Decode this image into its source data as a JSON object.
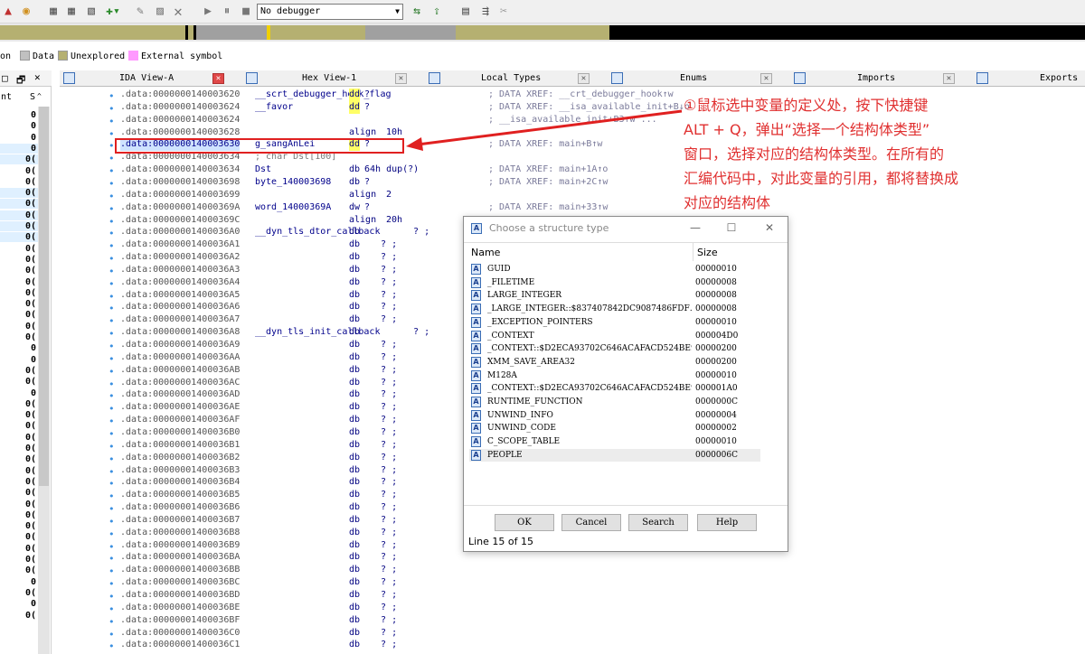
{
  "toolbar": {
    "debugger_select": "No debugger",
    "icons": [
      "disassembly-icon",
      "search-icon",
      "segment-icon",
      "segment-icon",
      "data-icon",
      "arrow-icon",
      "text-icon",
      "undefine-icon",
      "play-icon",
      "pause-icon",
      "stop-icon",
      "xref-icon",
      "graph-icon",
      "breakpoint-icon",
      "tools-icon"
    ]
  },
  "legend": {
    "items": [
      {
        "label": "on",
        "color": "#ffffff"
      },
      {
        "label": "Data",
        "color": "#c0c0c0"
      },
      {
        "label": "Unexplored",
        "color": "#b5b071"
      },
      {
        "label": "External symbol",
        "color": "#ff99ff"
      }
    ]
  },
  "left_panel": {
    "col1": "nt",
    "col2": "S",
    "rows": [
      "0",
      "0",
      "0",
      "0",
      "0(",
      "0(",
      "0(",
      "0(",
      "0(",
      "0(",
      "0(",
      "0(",
      "0(",
      "0(",
      "0(",
      "0(",
      "0(",
      "0(",
      "0(",
      "0(",
      "0(",
      "0",
      "0",
      "0(",
      "0(",
      "0",
      "0(",
      "0(",
      "0(",
      "0(",
      "0(",
      "0(",
      "0(",
      "0(",
      "0(",
      "0(",
      "0(",
      "0(",
      "0(",
      "0(",
      "0(",
      "0(",
      "0",
      "0(",
      "0",
      "0("
    ]
  },
  "tabs": [
    {
      "label": "IDA View-A",
      "active": true
    },
    {
      "label": "Hex View-1",
      "active": false
    },
    {
      "label": "Local Types",
      "active": false
    },
    {
      "label": "Enums",
      "active": false
    },
    {
      "label": "Imports",
      "active": false
    },
    {
      "label": "Exports",
      "active": false
    }
  ],
  "disasm": [
    {
      "addr": ".data:0000000140003620",
      "name": "__scrt_debugger_hook_flag",
      "op": "dd",
      "arg": "?",
      "cmt": "; DATA XREF: __crt_debugger_hook↑w",
      "hl_op": true
    },
    {
      "addr": ".data:0000000140003624",
      "name": "__favor",
      "op": "dd",
      "arg": "?",
      "cmt": "; DATA XREF: __isa_available_init+B↓o",
      "hl_op": true
    },
    {
      "addr": ".data:0000000140003624",
      "name": "",
      "op": "",
      "arg": "",
      "cmt": "; __isa_available_init+B3↑w ..."
    },
    {
      "addr": ".data:0000000140003628",
      "name": "",
      "op": "align",
      "arg": "10h",
      "cmt": ""
    },
    {
      "addr": ".data:0000000140003630",
      "name": "g_sangAnLei",
      "op": "dd",
      "arg": "?",
      "cmt": "; DATA XREF: main+B↑w",
      "hl_op": true,
      "hl_addr": true
    },
    {
      "addr": ".data:0000000140003634",
      "name": "; char Dst[100]",
      "op": "",
      "arg": "",
      "cmt": "",
      "comment_line": true
    },
    {
      "addr": ".data:0000000140003634",
      "name": "Dst",
      "op": "db",
      "arg": "64h dup(?)",
      "cmt": "; DATA XREF: main+1A↑o"
    },
    {
      "addr": ".data:0000000140003698",
      "name": "byte_140003698",
      "op": "db",
      "arg": "?",
      "cmt": "; DATA XREF: main+2C↑w"
    },
    {
      "addr": ".data:0000000140003699",
      "name": "",
      "op": "align",
      "arg": "2",
      "cmt": ""
    },
    {
      "addr": ".data:000000014000369A",
      "name": "word_14000369A",
      "op": "dw",
      "arg": "?",
      "cmt": "; DATA XREF: main+33↑w"
    },
    {
      "addr": ".data:000000014000369C",
      "name": "",
      "op": "align",
      "arg": "20h",
      "cmt": ""
    },
    {
      "addr": ".data:00000001400036A0",
      "name": "__dyn_tls_dtor_callback",
      "op": "db",
      "arg": "   ? ;",
      "cmt": ""
    },
    {
      "addr": ".data:00000001400036A1",
      "name": "",
      "op": "db",
      "arg": "   ? ;",
      "cmt": ""
    },
    {
      "addr": ".data:00000001400036A2",
      "name": "",
      "op": "db",
      "arg": "   ? ;",
      "cmt": ""
    },
    {
      "addr": ".data:00000001400036A3",
      "name": "",
      "op": "db",
      "arg": "   ? ;",
      "cmt": ""
    },
    {
      "addr": ".data:00000001400036A4",
      "name": "",
      "op": "db",
      "arg": "   ? ;",
      "cmt": ""
    },
    {
      "addr": ".data:00000001400036A5",
      "name": "",
      "op": "db",
      "arg": "   ? ;",
      "cmt": ""
    },
    {
      "addr": ".data:00000001400036A6",
      "name": "",
      "op": "db",
      "arg": "   ? ;",
      "cmt": ""
    },
    {
      "addr": ".data:00000001400036A7",
      "name": "",
      "op": "db",
      "arg": "   ? ;",
      "cmt": ""
    },
    {
      "addr": ".data:00000001400036A8",
      "name": "__dyn_tls_init_callback",
      "op": "db",
      "arg": "   ? ;",
      "cmt": ""
    },
    {
      "addr": ".data:00000001400036A9",
      "name": "",
      "op": "db",
      "arg": "   ? ;",
      "cmt": ""
    },
    {
      "addr": ".data:00000001400036AA",
      "name": "",
      "op": "db",
      "arg": "   ? ;",
      "cmt": ""
    },
    {
      "addr": ".data:00000001400036AB",
      "name": "",
      "op": "db",
      "arg": "   ? ;",
      "cmt": ""
    },
    {
      "addr": ".data:00000001400036AC",
      "name": "",
      "op": "db",
      "arg": "   ? ;",
      "cmt": ""
    },
    {
      "addr": ".data:00000001400036AD",
      "name": "",
      "op": "db",
      "arg": "   ? ;",
      "cmt": ""
    },
    {
      "addr": ".data:00000001400036AE",
      "name": "",
      "op": "db",
      "arg": "   ? ;",
      "cmt": ""
    },
    {
      "addr": ".data:00000001400036AF",
      "name": "",
      "op": "db",
      "arg": "   ? ;",
      "cmt": ""
    },
    {
      "addr": ".data:00000001400036B0",
      "name": "",
      "op": "db",
      "arg": "   ? ;",
      "cmt": ""
    },
    {
      "addr": ".data:00000001400036B1",
      "name": "",
      "op": "db",
      "arg": "   ? ;",
      "cmt": ""
    },
    {
      "addr": ".data:00000001400036B2",
      "name": "",
      "op": "db",
      "arg": "   ? ;",
      "cmt": ""
    },
    {
      "addr": ".data:00000001400036B3",
      "name": "",
      "op": "db",
      "arg": "   ? ;",
      "cmt": ""
    },
    {
      "addr": ".data:00000001400036B4",
      "name": "",
      "op": "db",
      "arg": "   ? ;",
      "cmt": ""
    },
    {
      "addr": ".data:00000001400036B5",
      "name": "",
      "op": "db",
      "arg": "   ? ;",
      "cmt": ""
    },
    {
      "addr": ".data:00000001400036B6",
      "name": "",
      "op": "db",
      "arg": "   ? ;",
      "cmt": ""
    },
    {
      "addr": ".data:00000001400036B7",
      "name": "",
      "op": "db",
      "arg": "   ? ;",
      "cmt": ""
    },
    {
      "addr": ".data:00000001400036B8",
      "name": "",
      "op": "db",
      "arg": "   ? ;",
      "cmt": ""
    },
    {
      "addr": ".data:00000001400036B9",
      "name": "",
      "op": "db",
      "arg": "   ? ;",
      "cmt": ""
    },
    {
      "addr": ".data:00000001400036BA",
      "name": "",
      "op": "db",
      "arg": "   ? ;",
      "cmt": ""
    },
    {
      "addr": ".data:00000001400036BB",
      "name": "",
      "op": "db",
      "arg": "   ? ;",
      "cmt": ""
    },
    {
      "addr": ".data:00000001400036BC",
      "name": "",
      "op": "db",
      "arg": "   ? ;",
      "cmt": ""
    },
    {
      "addr": ".data:00000001400036BD",
      "name": "",
      "op": "db",
      "arg": "   ? ;",
      "cmt": ""
    },
    {
      "addr": ".data:00000001400036BE",
      "name": "",
      "op": "db",
      "arg": "   ? ;",
      "cmt": ""
    },
    {
      "addr": ".data:00000001400036BF",
      "name": "",
      "op": "db",
      "arg": "   ? ;",
      "cmt": ""
    },
    {
      "addr": ".data:00000001400036C0",
      "name": "",
      "op": "db",
      "arg": "   ? ;",
      "cmt": ""
    },
    {
      "addr": ".data:00000001400036C1",
      "name": "",
      "op": "db",
      "arg": "   ? ;",
      "cmt": ""
    }
  ],
  "annotation": {
    "lines": [
      "①鼠标选中变量的定义处，按下快捷键",
      "ALT + Q，弹出“选择一个结构体类型”",
      "窗口，选择对应的结构体类型。在所有的",
      "汇编代码中，对此变量的引用，都将替换成",
      "对应的结构体"
    ],
    "color": "#e03030"
  },
  "dialog": {
    "title": "Choose a structure type",
    "col_name": "Name",
    "col_size": "Size",
    "rows": [
      {
        "name": "GUID",
        "size": "00000010"
      },
      {
        "name": "_FILETIME",
        "size": "00000008"
      },
      {
        "name": "LARGE_INTEGER",
        "size": "00000008"
      },
      {
        "name": "_LARGE_INTEGER::$837407842DC9087486FDF…",
        "size": "00000008"
      },
      {
        "name": "_EXCEPTION_POINTERS",
        "size": "00000010"
      },
      {
        "name": "_CONTEXT",
        "size": "000004D0"
      },
      {
        "name": "_CONTEXT::$D2ECA93702C646ACAFACD524BE9…",
        "size": "00000200"
      },
      {
        "name": "XMM_SAVE_AREA32",
        "size": "00000200"
      },
      {
        "name": "M128A",
        "size": "00000010"
      },
      {
        "name": "_CONTEXT::$D2ECA93702C646ACAFACD524BE9…",
        "size": "000001A0"
      },
      {
        "name": "RUNTIME_FUNCTION",
        "size": "0000000C"
      },
      {
        "name": "UNWIND_INFO",
        "size": "00000004"
      },
      {
        "name": "UNWIND_CODE",
        "size": "00000002"
      },
      {
        "name": "C_SCOPE_TABLE",
        "size": "00000010"
      },
      {
        "name": "PEOPLE",
        "size": "0000006C",
        "selected": true
      }
    ],
    "buttons": {
      "ok": "OK",
      "cancel": "Cancel",
      "search": "Search",
      "help": "Help"
    },
    "status": "Line 15 of 15"
  }
}
